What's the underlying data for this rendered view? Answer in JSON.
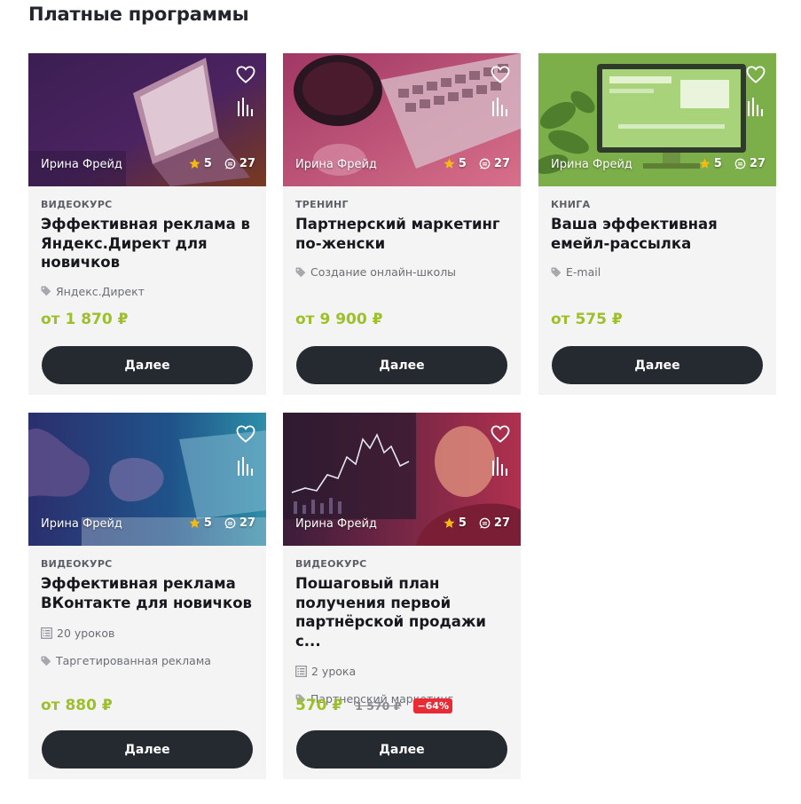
{
  "page": {
    "title": "Платные программы"
  },
  "cards": [
    {
      "author": "Ирина Фрейд",
      "rating": "5",
      "comments": "27",
      "type": "Видеокурс",
      "title": "Эффективная реклама в Яндекс.Директ для новичков",
      "lessons": "",
      "tag": "Яндекс.Директ",
      "price": "от 1 870 ₽",
      "old_price": "",
      "discount": "",
      "button": "Далее",
      "overlay_color": "#6b2a78"
    },
    {
      "author": "Ирина Фрейд",
      "rating": "5",
      "comments": "27",
      "type": "Тренинг",
      "title": "Партнерский маркетинг по-женски",
      "lessons": "",
      "tag": "Создание онлайн-школы",
      "price": "от 9 900 ₽",
      "old_price": "",
      "discount": "",
      "button": "Далее",
      "overlay_color": "#b9436d"
    },
    {
      "author": "Ирина Фрейд",
      "rating": "5",
      "comments": "27",
      "type": "Книга",
      "title": "Ваша эффективная емейл-рассылка",
      "lessons": "",
      "tag": "E-mail",
      "price": "от 575 ₽",
      "old_price": "",
      "discount": "",
      "button": "Далее",
      "overlay_color": "#7cb542"
    },
    {
      "author": "Ирина Фрейд",
      "rating": "5",
      "comments": "27",
      "type": "Видеокурс",
      "title": "Эффективная реклама ВКонтакте для новичков",
      "lessons": "20 уроков",
      "tag": "Таргетированная реклама",
      "price": "от 880 ₽",
      "old_price": "",
      "discount": "",
      "button": "Далее",
      "overlay_color": "#1f5c8a"
    },
    {
      "author": "Ирина Фрейд",
      "rating": "5",
      "comments": "27",
      "type": "Видеокурс",
      "title": "Пошаговый план получения первой партнёрской продажи с...",
      "lessons": "2 урока",
      "tag": "Партнерский маркетинг",
      "price": "570 ₽",
      "old_price": "1 570 ₽",
      "discount": "−64%",
      "button": "Далее",
      "overlay_color": "#a02a4e"
    }
  ]
}
